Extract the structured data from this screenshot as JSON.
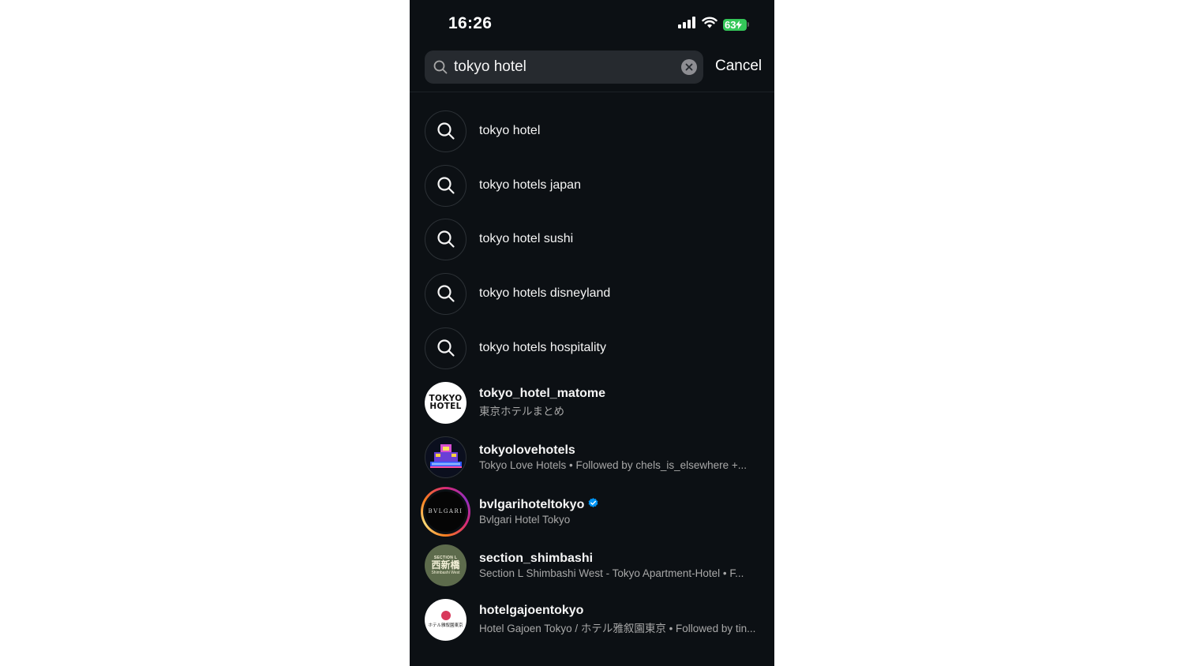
{
  "status_bar": {
    "time": "16:26",
    "battery": "63"
  },
  "search": {
    "value": "tokyo hotel",
    "cancel_label": "Cancel"
  },
  "suggestions": [
    {
      "label": "tokyo hotel"
    },
    {
      "label": "tokyo hotels japan"
    },
    {
      "label": "tokyo hotel sushi"
    },
    {
      "label": "tokyo hotels disneyland"
    },
    {
      "label": "tokyo hotels hospitality"
    }
  ],
  "accounts": [
    {
      "username": "tokyo_hotel_matome",
      "subtitle": "東京ホテルまとめ",
      "avatar_text": [
        "TOKYO",
        "HOTEL"
      ]
    },
    {
      "username": "tokyolovehotels",
      "subtitle": "Tokyo Love Hotels • Followed by chels_is_elsewhere +..."
    },
    {
      "username": "bvlgarihoteltokyo",
      "subtitle": "Bvlgari Hotel Tokyo",
      "verified": true,
      "has_story": true,
      "avatar_text": "BVLGARI"
    },
    {
      "username": "section_shimbashi",
      "subtitle": "Section L Shimbashi West - Tokyo Apartment-Hotel • F...",
      "avatar_text": [
        "SECTION L",
        "西新橋",
        "Shimbashi West"
      ]
    },
    {
      "username": "hotelgajoentokyo",
      "subtitle": "Hotel Gajoen Tokyo / ホテル雅叙園東京 • Followed by tin...",
      "avatar_text": "ホテル雅叙園東京"
    }
  ],
  "colors": {
    "background": "#0c1014",
    "search_field": "#262a2f",
    "verified_blue": "#0095f6",
    "battery_green": "#34c759"
  }
}
